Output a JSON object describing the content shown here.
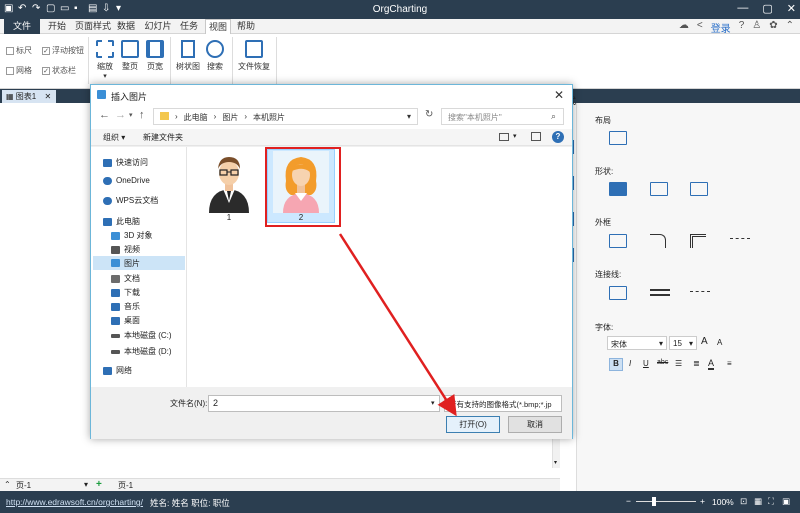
{
  "app_title": "OrgCharting",
  "menu_tabs": [
    "文件",
    "开始",
    "页面样式",
    "数据",
    "幻灯片",
    "任务",
    "视图",
    "帮助"
  ],
  "menu_active": "视图",
  "top_right": {
    "login": "登录"
  },
  "ribbon": {
    "checkboxes": [
      {
        "label": "标尺",
        "checked": false
      },
      {
        "label": "浮动按钮",
        "checked": true
      },
      {
        "label": "网格",
        "checked": false
      },
      {
        "label": "状态栏",
        "checked": true
      }
    ],
    "buttons": [
      "缩放",
      "整页",
      "页宽",
      "树状图",
      "搜索",
      "文件恢复"
    ]
  },
  "doc_tab": "图表1",
  "right_panel": {
    "partial_title": "式",
    "layout": "布局",
    "shape": "形状:",
    "border": "外框",
    "connector": "连接线:",
    "font": "字体:",
    "font_name": "宋体",
    "font_size": "15",
    "font_sample": "A"
  },
  "page_bar": {
    "current": "页-1",
    "tab": "页-1"
  },
  "status": {
    "url": "http://www.edrawsoft.cn/orgcharting/",
    "info": "姓名: 姓名  职位: 职位",
    "zoom": "100%"
  },
  "dialog": {
    "title": "插入图片",
    "close": "✕",
    "address": [
      "此电脑",
      "图片",
      "本机照片"
    ],
    "search_placeholder": "搜索\"本机照片\"",
    "organize": "组织 ▾",
    "new_folder": "新建文件夹",
    "help": "?",
    "sidebar": [
      {
        "label": "快速访问",
        "icon": "star-icon",
        "color": "#2e6fb5"
      },
      {
        "label": "OneDrive",
        "icon": "cloud-icon",
        "color": "#2e6fb5"
      },
      {
        "label": "WPS云文档",
        "icon": "cloud-icon",
        "color": "#2e6fb5"
      },
      {
        "label": "此电脑",
        "icon": "computer-icon",
        "color": "#2e6fb5"
      },
      {
        "label": "3D 对象",
        "icon": "cube-icon",
        "color": "#3b8fd6"
      },
      {
        "label": "视频",
        "icon": "video-icon",
        "color": "#555"
      },
      {
        "label": "图片",
        "icon": "picture-icon",
        "color": "#3b8fd6",
        "selected": true
      },
      {
        "label": "文档",
        "icon": "document-icon",
        "color": "#6c6c6c"
      },
      {
        "label": "下载",
        "icon": "download-icon",
        "color": "#2e6fb5"
      },
      {
        "label": "音乐",
        "icon": "music-icon",
        "color": "#2e6fb5"
      },
      {
        "label": "桌面",
        "icon": "desktop-icon",
        "color": "#2e6fb5"
      },
      {
        "label": "本地磁盘 (C:)",
        "icon": "drive-icon",
        "color": "#555"
      },
      {
        "label": "本地磁盘 (D:)",
        "icon": "drive-icon",
        "color": "#555"
      },
      {
        "label": "网络",
        "icon": "network-icon",
        "color": "#2e6fb5"
      }
    ],
    "files": [
      {
        "name": "1",
        "selected": false
      },
      {
        "name": "2",
        "selected": true
      }
    ],
    "filename_label": "文件名(N):",
    "filename_value": "2",
    "filetype_value": "所有支持的图像格式(*.bmp;*.jp",
    "open_button": "打开(O)",
    "cancel_button": "取消"
  },
  "colors": {
    "title_bar": "#2b3e50",
    "accent": "#2e6fb5",
    "highlight": "#e02020"
  }
}
